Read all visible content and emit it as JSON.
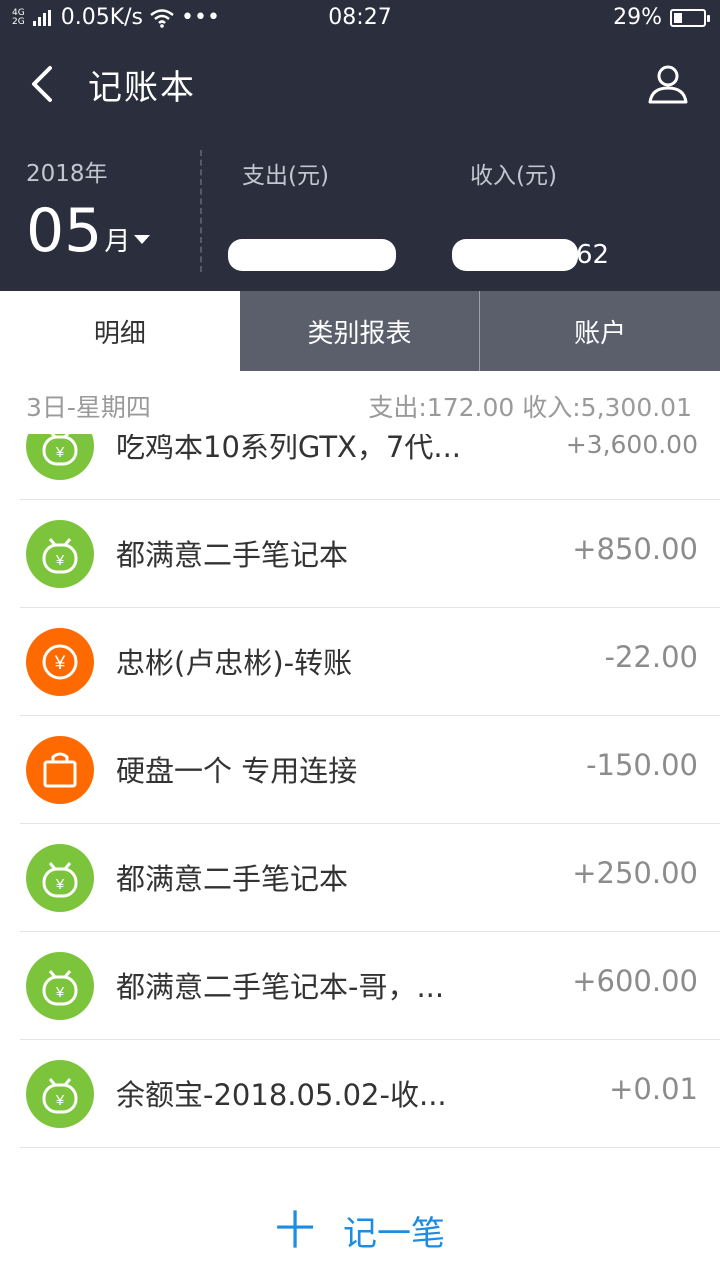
{
  "status": {
    "network_top": "4G",
    "network_bottom": "2G",
    "speed": "0.05K/s",
    "more": "•••",
    "time": "08:27",
    "battery": "29%",
    "battery_level": 0.29
  },
  "header": {
    "title": "记账本",
    "year": "2018年",
    "month": "05",
    "month_unit": "月",
    "expense_label": "支出(元)",
    "income_label": "收入(元)",
    "income_value_visible": "62"
  },
  "tabs": [
    {
      "label": "明细"
    },
    {
      "label": "类别报表"
    },
    {
      "label": "账户"
    }
  ],
  "day": {
    "date": "3日-星期四",
    "summary": "支出:172.00 收入:5,300.01"
  },
  "transactions": [
    {
      "icon": "money-bag-icon",
      "color": "#7cc43c",
      "label": "吃鸡本10系列GTX，7代...",
      "amount": "+3,600.00"
    },
    {
      "icon": "money-bag-icon",
      "color": "#7cc43c",
      "label": "都满意二手笔记本",
      "amount": "+850.00"
    },
    {
      "icon": "yuan-coin-icon",
      "color": "#ff6a00",
      "label": "忠彬(卢忠彬)-转账",
      "amount": "-22.00"
    },
    {
      "icon": "shopping-bag-icon",
      "color": "#ff6a00",
      "label": "硬盘一个 专用连接",
      "amount": "-150.00"
    },
    {
      "icon": "money-bag-icon",
      "color": "#7cc43c",
      "label": "都满意二手笔记本",
      "amount": "+250.00"
    },
    {
      "icon": "money-bag-icon",
      "color": "#7cc43c",
      "label": "都满意二手笔记本-哥，...",
      "amount": "+600.00"
    },
    {
      "icon": "money-bag-icon",
      "color": "#7cc43c",
      "label": "余额宝-2018.05.02-收...",
      "amount": "+0.01"
    }
  ],
  "bottom": {
    "plus": "十",
    "add_label": "记一笔"
  },
  "colors": {
    "header_bg": "#2a2e3d",
    "accent_blue": "#1e8ce0",
    "income_green": "#7cc43c",
    "expense_orange": "#ff6a00"
  }
}
